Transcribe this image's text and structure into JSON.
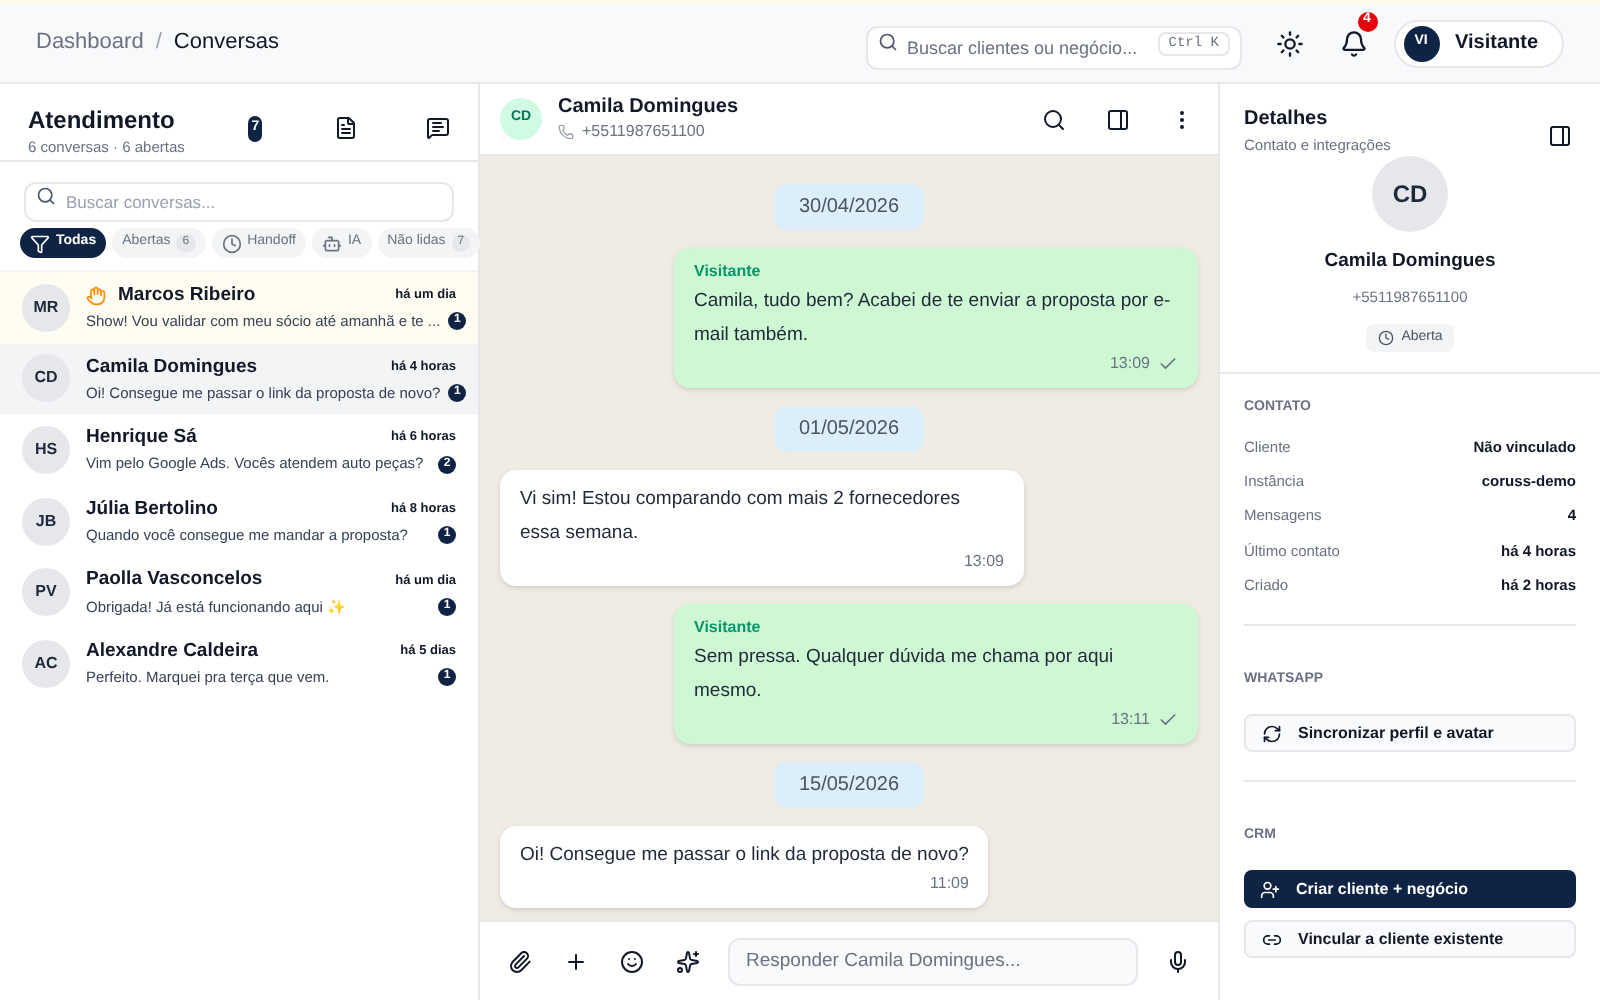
{
  "breadcrumb": {
    "parent": "Dashboard",
    "separator": "/",
    "current": "Conversas"
  },
  "search": {
    "placeholder": "Buscar clientes ou negócio...",
    "shortcut": "Ctrl K"
  },
  "notifications": {
    "count": "4"
  },
  "user": {
    "initials": "VI",
    "name": "Visitante"
  },
  "inbox": {
    "title": "Atendimento",
    "subtitle": "6 conversas · 6 abertas",
    "badge": "7",
    "search_placeholder": "Buscar conversas...",
    "filters": [
      {
        "label": "Todas",
        "selected": true
      },
      {
        "label": "Abertas",
        "count": "6",
        "selected": false
      },
      {
        "label": "Handoff",
        "selected": false
      },
      {
        "label": "IA",
        "selected": false
      },
      {
        "label": "Não lidas",
        "count": "7",
        "selected": false
      }
    ],
    "conversations": [
      {
        "initials": "MR",
        "name": "Marcos Ribeiro",
        "time": "há um dia",
        "preview": "Show! Vou validar com meu sócio até amanhã e te ...",
        "unread": "1",
        "handoff": true,
        "selected": false
      },
      {
        "initials": "CD",
        "name": "Camila Domingues",
        "time": "há 4 horas",
        "preview": "Oi! Consegue me passar o link da proposta de novo?",
        "unread": "1",
        "handoff": false,
        "selected": true
      },
      {
        "initials": "HS",
        "name": "Henrique Sá",
        "time": "há 6 horas",
        "preview": "Vim pelo Google Ads. Vocês atendem auto peças?",
        "unread": "2",
        "handoff": false,
        "selected": false
      },
      {
        "initials": "JB",
        "name": "Júlia Bertolino",
        "time": "há 8 horas",
        "preview": "Quando você consegue me mandar a proposta?",
        "unread": "1",
        "handoff": false,
        "selected": false
      },
      {
        "initials": "PV",
        "name": "Paolla Vasconcelos",
        "time": "há um dia",
        "preview": "Obrigada! Já está funcionando aqui ✨",
        "unread": "1",
        "handoff": false,
        "selected": false
      },
      {
        "initials": "AC",
        "name": "Alexandre Caldeira",
        "time": "há 5 dias",
        "preview": "Perfeito. Marquei pra terça que vem.",
        "unread": "1",
        "handoff": false,
        "selected": false
      }
    ]
  },
  "chat": {
    "initials": "CD",
    "name": "Camila Domingues",
    "phone": "+5511987651100",
    "messages": [
      {
        "kind": "date",
        "text": "30/04/2026"
      },
      {
        "kind": "outgoing",
        "sender": "Visitante",
        "text": "Camila, tudo bem? Acabei de te enviar a proposta por e-mail também.",
        "time": "13:09"
      },
      {
        "kind": "date",
        "text": "01/05/2026"
      },
      {
        "kind": "incoming",
        "text": "Vi sim! Estou comparando com mais 2 fornecedores essa semana.",
        "time": "13:09"
      },
      {
        "kind": "outgoing",
        "sender": "Visitante",
        "text": "Sem pressa. Qualquer dúvida me chama por aqui mesmo.",
        "time": "13:11"
      },
      {
        "kind": "date",
        "text": "15/05/2026"
      },
      {
        "kind": "incoming",
        "text": "Oi! Consegue me passar o link da proposta de novo?",
        "time": "11:09"
      }
    ],
    "reply_placeholder": "Responder Camila Domingues..."
  },
  "details": {
    "title": "Detalhes",
    "subtitle": "Contato e integrações",
    "initials": "CD",
    "name": "Camila Domingues",
    "phone": "+5511987651100",
    "status": "Aberta",
    "contact_heading": "CONTATO",
    "fields": [
      {
        "label": "Cliente",
        "value": "Não vinculado"
      },
      {
        "label": "Instância",
        "value": "coruss-demo"
      },
      {
        "label": "Mensagens",
        "value": "4"
      },
      {
        "label": "Último contato",
        "value": "há 4 horas"
      },
      {
        "label": "Criado",
        "value": "há 2 horas"
      }
    ],
    "whatsapp_heading": "WHATSAPP",
    "sync_button": "Sincronizar perfil e avatar",
    "crm_heading": "CRM",
    "create_button": "Criar cliente + negócio",
    "link_button": "Vincular a cliente existente"
  }
}
